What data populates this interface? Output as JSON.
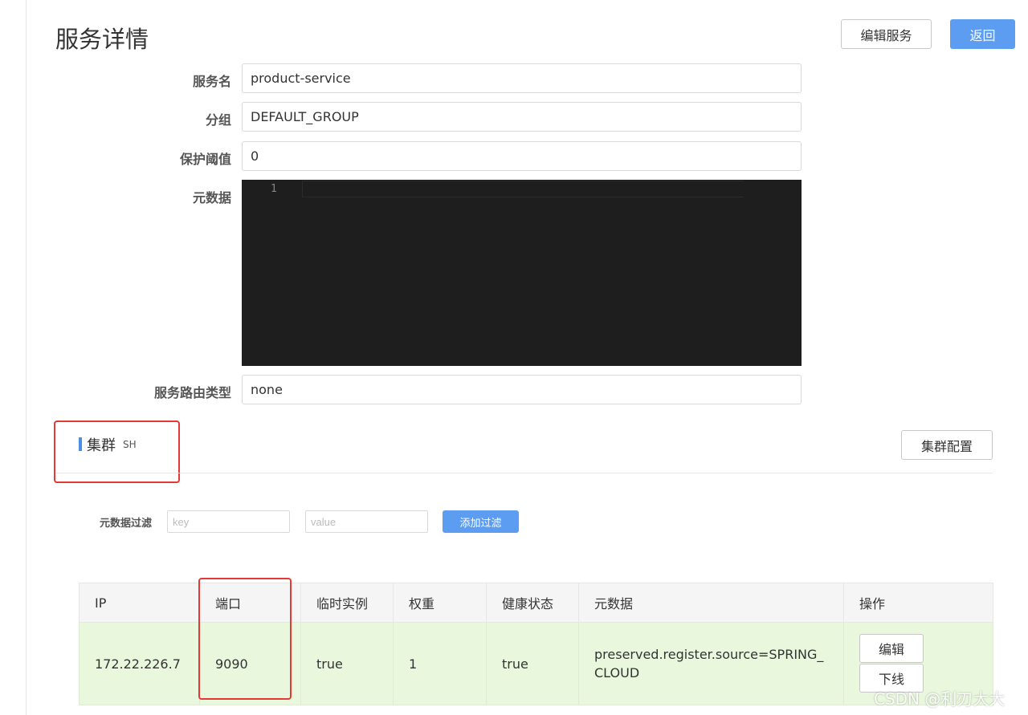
{
  "header": {
    "title": "服务详情",
    "edit_button": "编辑服务",
    "back_button": "返回"
  },
  "form": {
    "service_name_label": "服务名",
    "service_name_value": "product-service",
    "group_label": "分组",
    "group_value": "DEFAULT_GROUP",
    "protect_threshold_label": "保护阈值",
    "protect_threshold_value": "0",
    "metadata_label": "元数据",
    "metadata_line_number": "1",
    "route_type_label": "服务路由类型",
    "route_type_value": "none"
  },
  "cluster": {
    "title": "集群",
    "name": "SH",
    "config_button": "集群配置"
  },
  "filter": {
    "label": "元数据过滤",
    "key_placeholder": "key",
    "value_placeholder": "value",
    "add_button": "添加过滤"
  },
  "table": {
    "headers": [
      "IP",
      "端口",
      "临时实例",
      "权重",
      "健康状态",
      "元数据",
      "操作"
    ],
    "rows": [
      {
        "ip": "172.22.226.7",
        "port": "9090",
        "ephemeral": "true",
        "weight": "1",
        "healthy": "true",
        "metadata": "preserved.register.source=SPRING_CLOUD",
        "edit_button": "编辑",
        "offline_button": "下线"
      }
    ]
  },
  "watermark": "CSDN @利刃大大",
  "colors": {
    "primary": "#5c9df2",
    "row_healthy_bg": "#e9f8dd",
    "editor_bg": "#1e1e1e",
    "highlight_border": "#e53935"
  }
}
